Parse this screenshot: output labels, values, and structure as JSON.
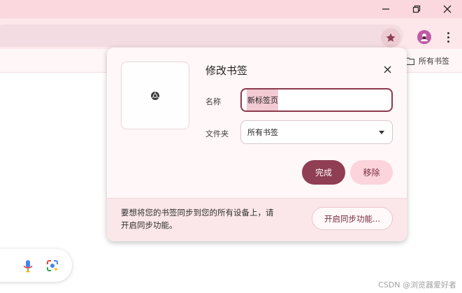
{
  "window": {
    "controls": [
      "minimize-icon",
      "restore-icon",
      "close-icon"
    ]
  },
  "toolbar": {
    "star_icon": "star-icon",
    "avatar_icon": "avatar-icon",
    "menu_icon": "more-vert-icon"
  },
  "bookmarks_bar": {
    "all_bookmarks_label": "所有书签",
    "folder_icon": "folder-icon"
  },
  "dialog": {
    "title": "修改书签",
    "name_label": "名称",
    "name_value": "新标签页",
    "folder_label": "文件夹",
    "folder_value": "所有书签",
    "done_label": "完成",
    "remove_label": "移除",
    "sync_text": "要想将您的书签同步到您的所有设备上，请开启同步功能。",
    "sync_button_label": "开启同步功能..."
  },
  "watermark": "CSDN @浏览器爱好者",
  "colors": {
    "titlebar": "#fbd7de",
    "toolbar": "#fde7ea",
    "accent": "#8f3e53",
    "remove_button": "#fbd4dc"
  }
}
